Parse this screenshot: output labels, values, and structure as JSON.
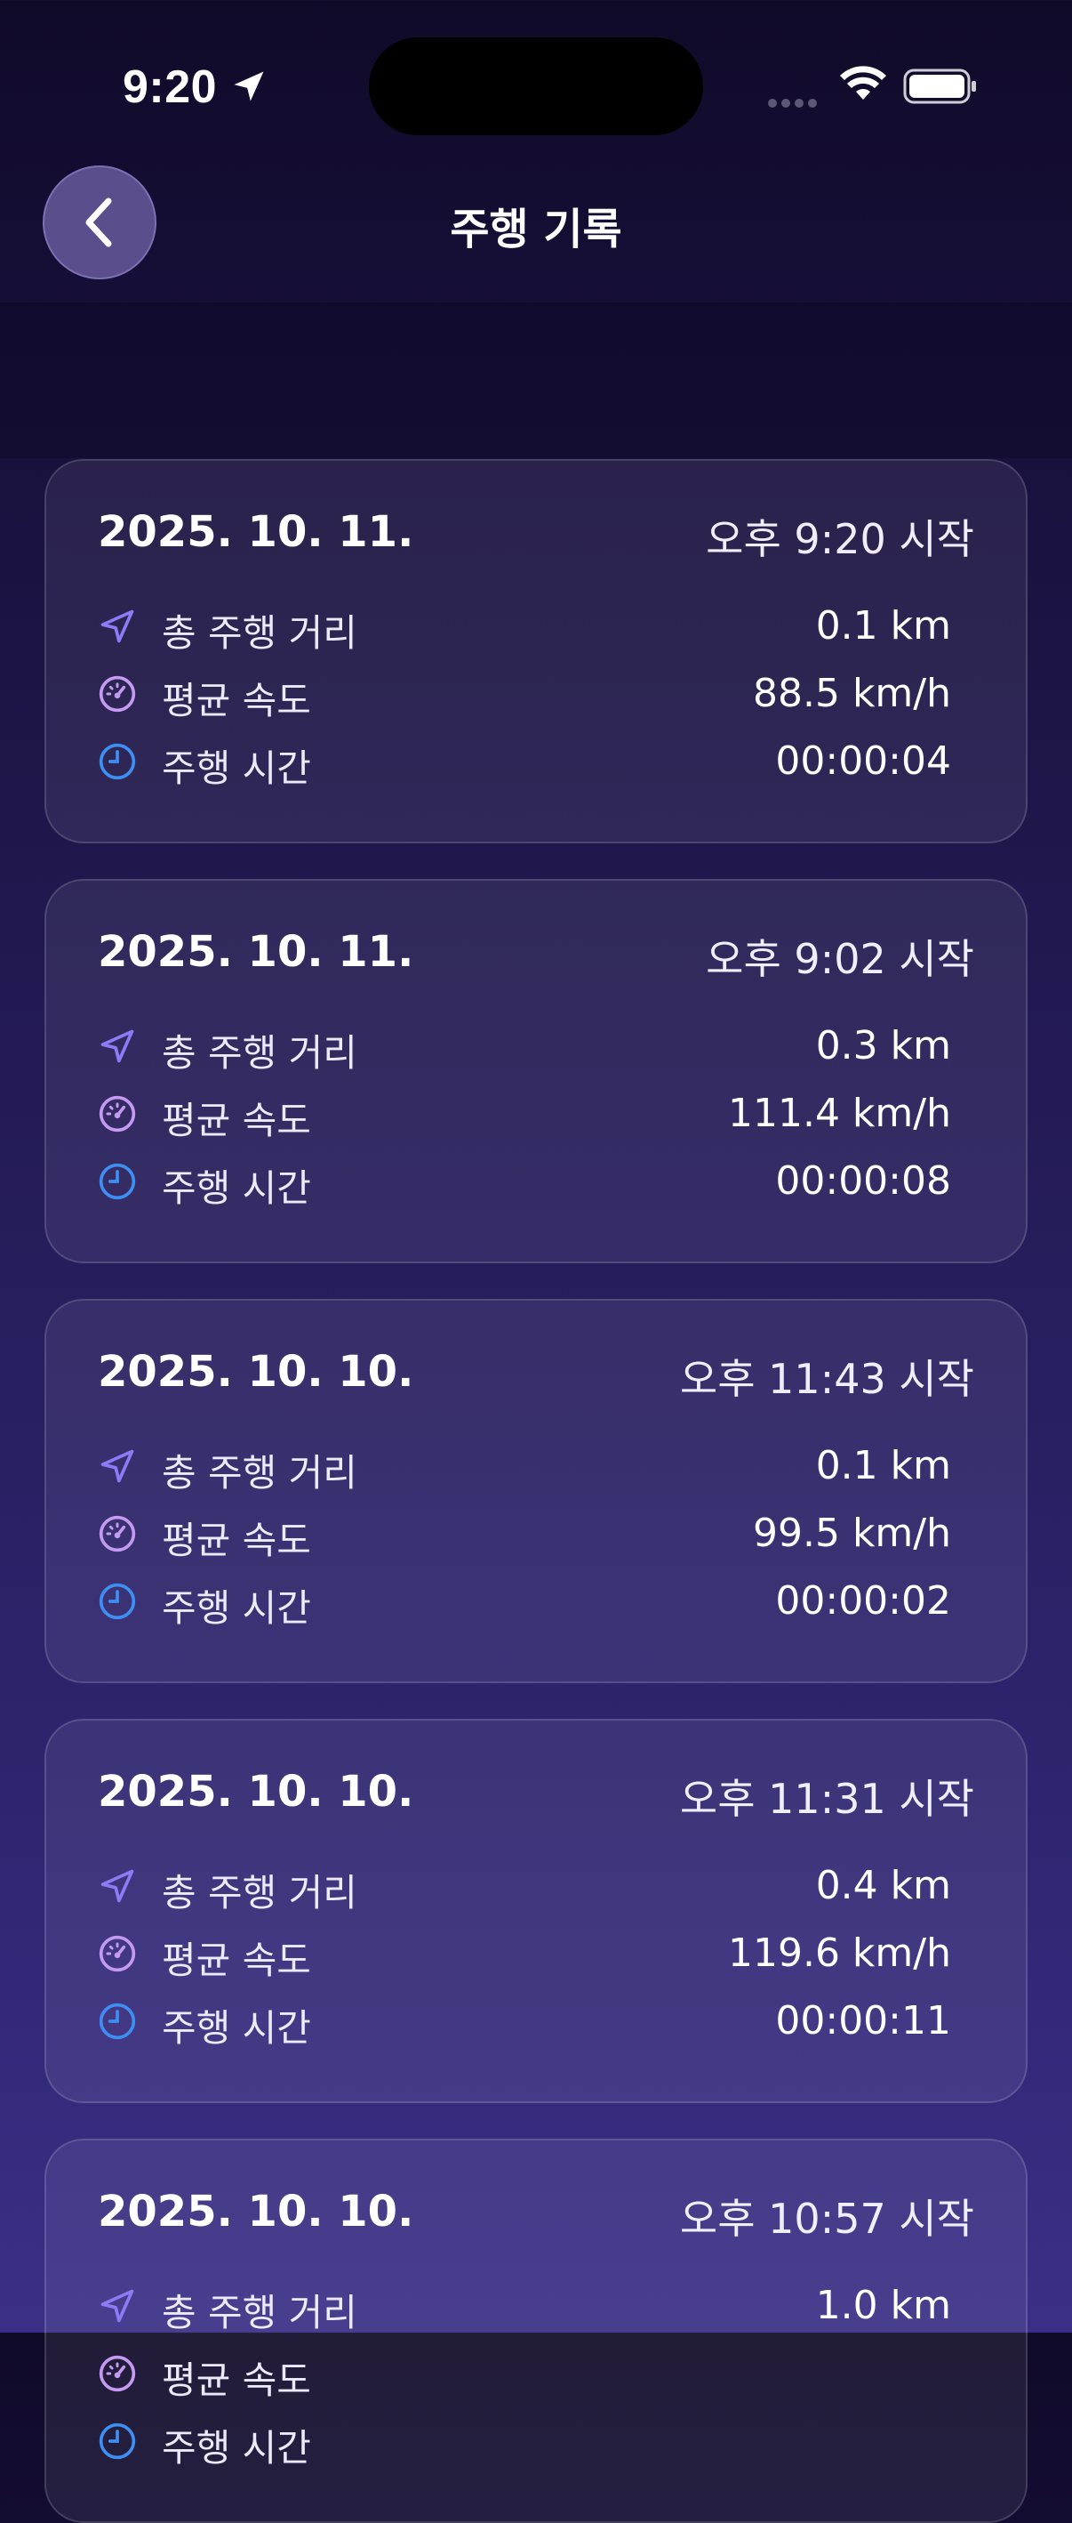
{
  "status_bar": {
    "time": "9:20"
  },
  "header": {
    "title": "주행 기록"
  },
  "records": [
    {
      "date": "2025. 10. 11.",
      "start": "오후 9:20 시작",
      "distance": "0.1 km",
      "speed": "88.5 km/h",
      "duration": "00:00:04"
    },
    {
      "date": "2025. 10. 11.",
      "start": "오후 9:02 시작",
      "distance": "0.3 km",
      "speed": "111.4 km/h",
      "duration": "00:00:08"
    },
    {
      "date": "2025. 10. 10.",
      "start": "오후 11:43 시작",
      "distance": "0.1 km",
      "speed": "99.5 km/h",
      "duration": "00:00:02"
    },
    {
      "date": "2025. 10. 10.",
      "start": "오후 11:31 시작",
      "distance": "0.4 km",
      "speed": "119.6 km/h",
      "duration": "00:00:11"
    },
    {
      "date": "2025. 10. 10.",
      "start": "오후 10:57 시작",
      "distance": "1.0 km",
      "speed": "",
      "duration": ""
    }
  ],
  "labels": {
    "distance": "총 주행 거리",
    "speed": "평균 속도",
    "duration": "주행 시간"
  },
  "icons": {
    "distance": "navigation-arrow-icon",
    "speed": "speedometer-icon",
    "duration": "clock-icon"
  },
  "colors": {
    "distance_icon": "#8b7cf6",
    "speed_icon": "#c49af2",
    "duration_icon": "#3f8ff2"
  }
}
